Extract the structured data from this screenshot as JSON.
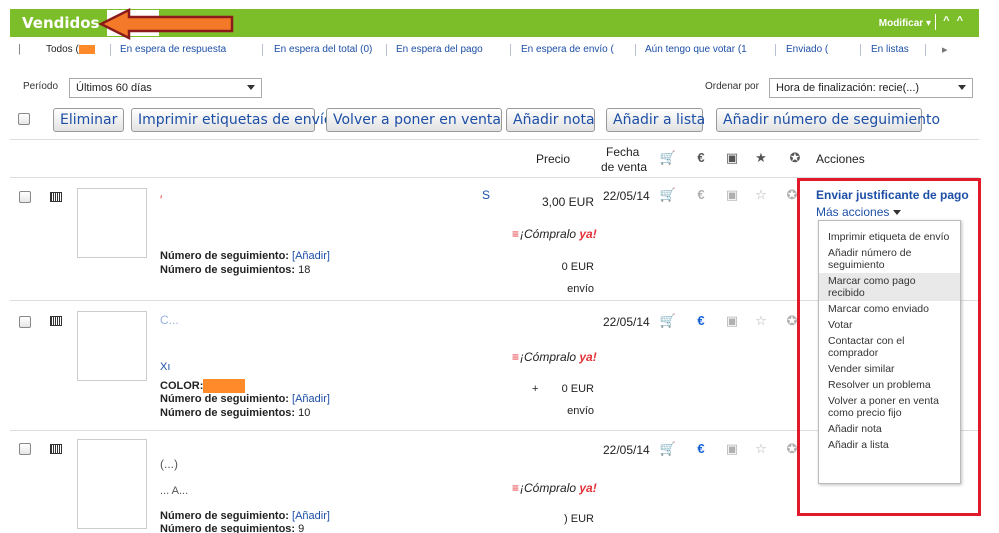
{
  "header": {
    "title": "Vendidos",
    "modificar_label": "Modificar ▾",
    "collapse_glyph": "^ ^"
  },
  "filters": {
    "items": [
      {
        "label": "Todos (",
        "active": true
      },
      {
        "label": "En espera de respuesta"
      },
      {
        "label": "En espera del total (0)"
      },
      {
        "label": "En espera del pago"
      },
      {
        "label": "En espera de envío ("
      },
      {
        "label": "Aún tengo que votar (1"
      },
      {
        "label": "Enviado ("
      },
      {
        "label": "En listas"
      }
    ],
    "prev_icon": "chevron-left-icon",
    "next_icon": "chevron-right-icon"
  },
  "period": {
    "label": "Período",
    "value": "Últimos 60 días"
  },
  "sort": {
    "label": "Ordenar por",
    "value": "Hora de finalización: recie(...)"
  },
  "toolbar": {
    "eliminar": "Eliminar",
    "imprimir": "Imprimir etiquetas de envío",
    "volver": "Volver a poner en venta",
    "nota": "Añadir nota",
    "lista": "Añadir a lista",
    "seguimiento": "Añadir número de seguimiento"
  },
  "columns": {
    "precio": "Precio",
    "fecha_line1": "Fecha",
    "fecha_line2": "de venta",
    "acciones": "Acciones",
    "icons": [
      "cart-icon",
      "euro-icon",
      "box-icon",
      "star-outline-icon",
      "star-filled-icon"
    ]
  },
  "rows": [
    {
      "title_fragment": "S",
      "tracking_label": "Número de seguimiento:",
      "tracking_link": "[Añadir]",
      "count_label": "Número de seguimientos:",
      "count": "18",
      "price": "3,00 EUR",
      "shipping": "0 EUR",
      "envio": "envío",
      "compralo_ya": "¡Cómpralo",
      "ya": "ya!",
      "date": "22/05/14",
      "status": {
        "paid": false,
        "shipped": false
      }
    },
    {
      "title_fragment": "C...",
      "extra_line": "Xı",
      "color_label": "COLOR:",
      "tracking_label": "Número de seguimiento:",
      "tracking_link": "[Añadir]",
      "count_label": "Número de seguimientos:",
      "count": "10",
      "shipping_prefix": "+",
      "shipping": "0 EUR",
      "envio": "envío",
      "compralo_ya": "¡Cómpralo",
      "ya": "ya!",
      "date": "22/05/14",
      "status": {
        "paid": true,
        "shipped": false
      }
    },
    {
      "title_fragment": "(...)",
      "extra_line": "... A...",
      "tracking_label": "Número de seguimiento:",
      "tracking_link": "[Añadir]",
      "count_label": "Número de seguimientos:",
      "count": "9",
      "shipping": ") EUR",
      "compralo_ya": "¡Cómpralo",
      "ya": "ya!",
      "date": "22/05/14",
      "status": {
        "paid": true,
        "shipped": false
      }
    }
  ],
  "actions": {
    "primary": "Enviar justificante de pago",
    "more": "Más acciones",
    "menu": [
      "Imprimir etiqueta de envío",
      "Añadir número de seguimiento",
      "Marcar como pago recibido",
      "Marcar como enviado",
      "Votar",
      "Contactar con el comprador",
      "Vender similar",
      "Resolver un problema",
      "Volver a poner en venta como precio fijo",
      "Añadir nota",
      "Añadir a lista"
    ],
    "hovered_index": 2
  },
  "colors": {
    "green_bar": "#7cbe2a",
    "link_blue": "#1d4fa6",
    "highlight_red": "#e01a2a",
    "orange": "#ff8a2a"
  }
}
